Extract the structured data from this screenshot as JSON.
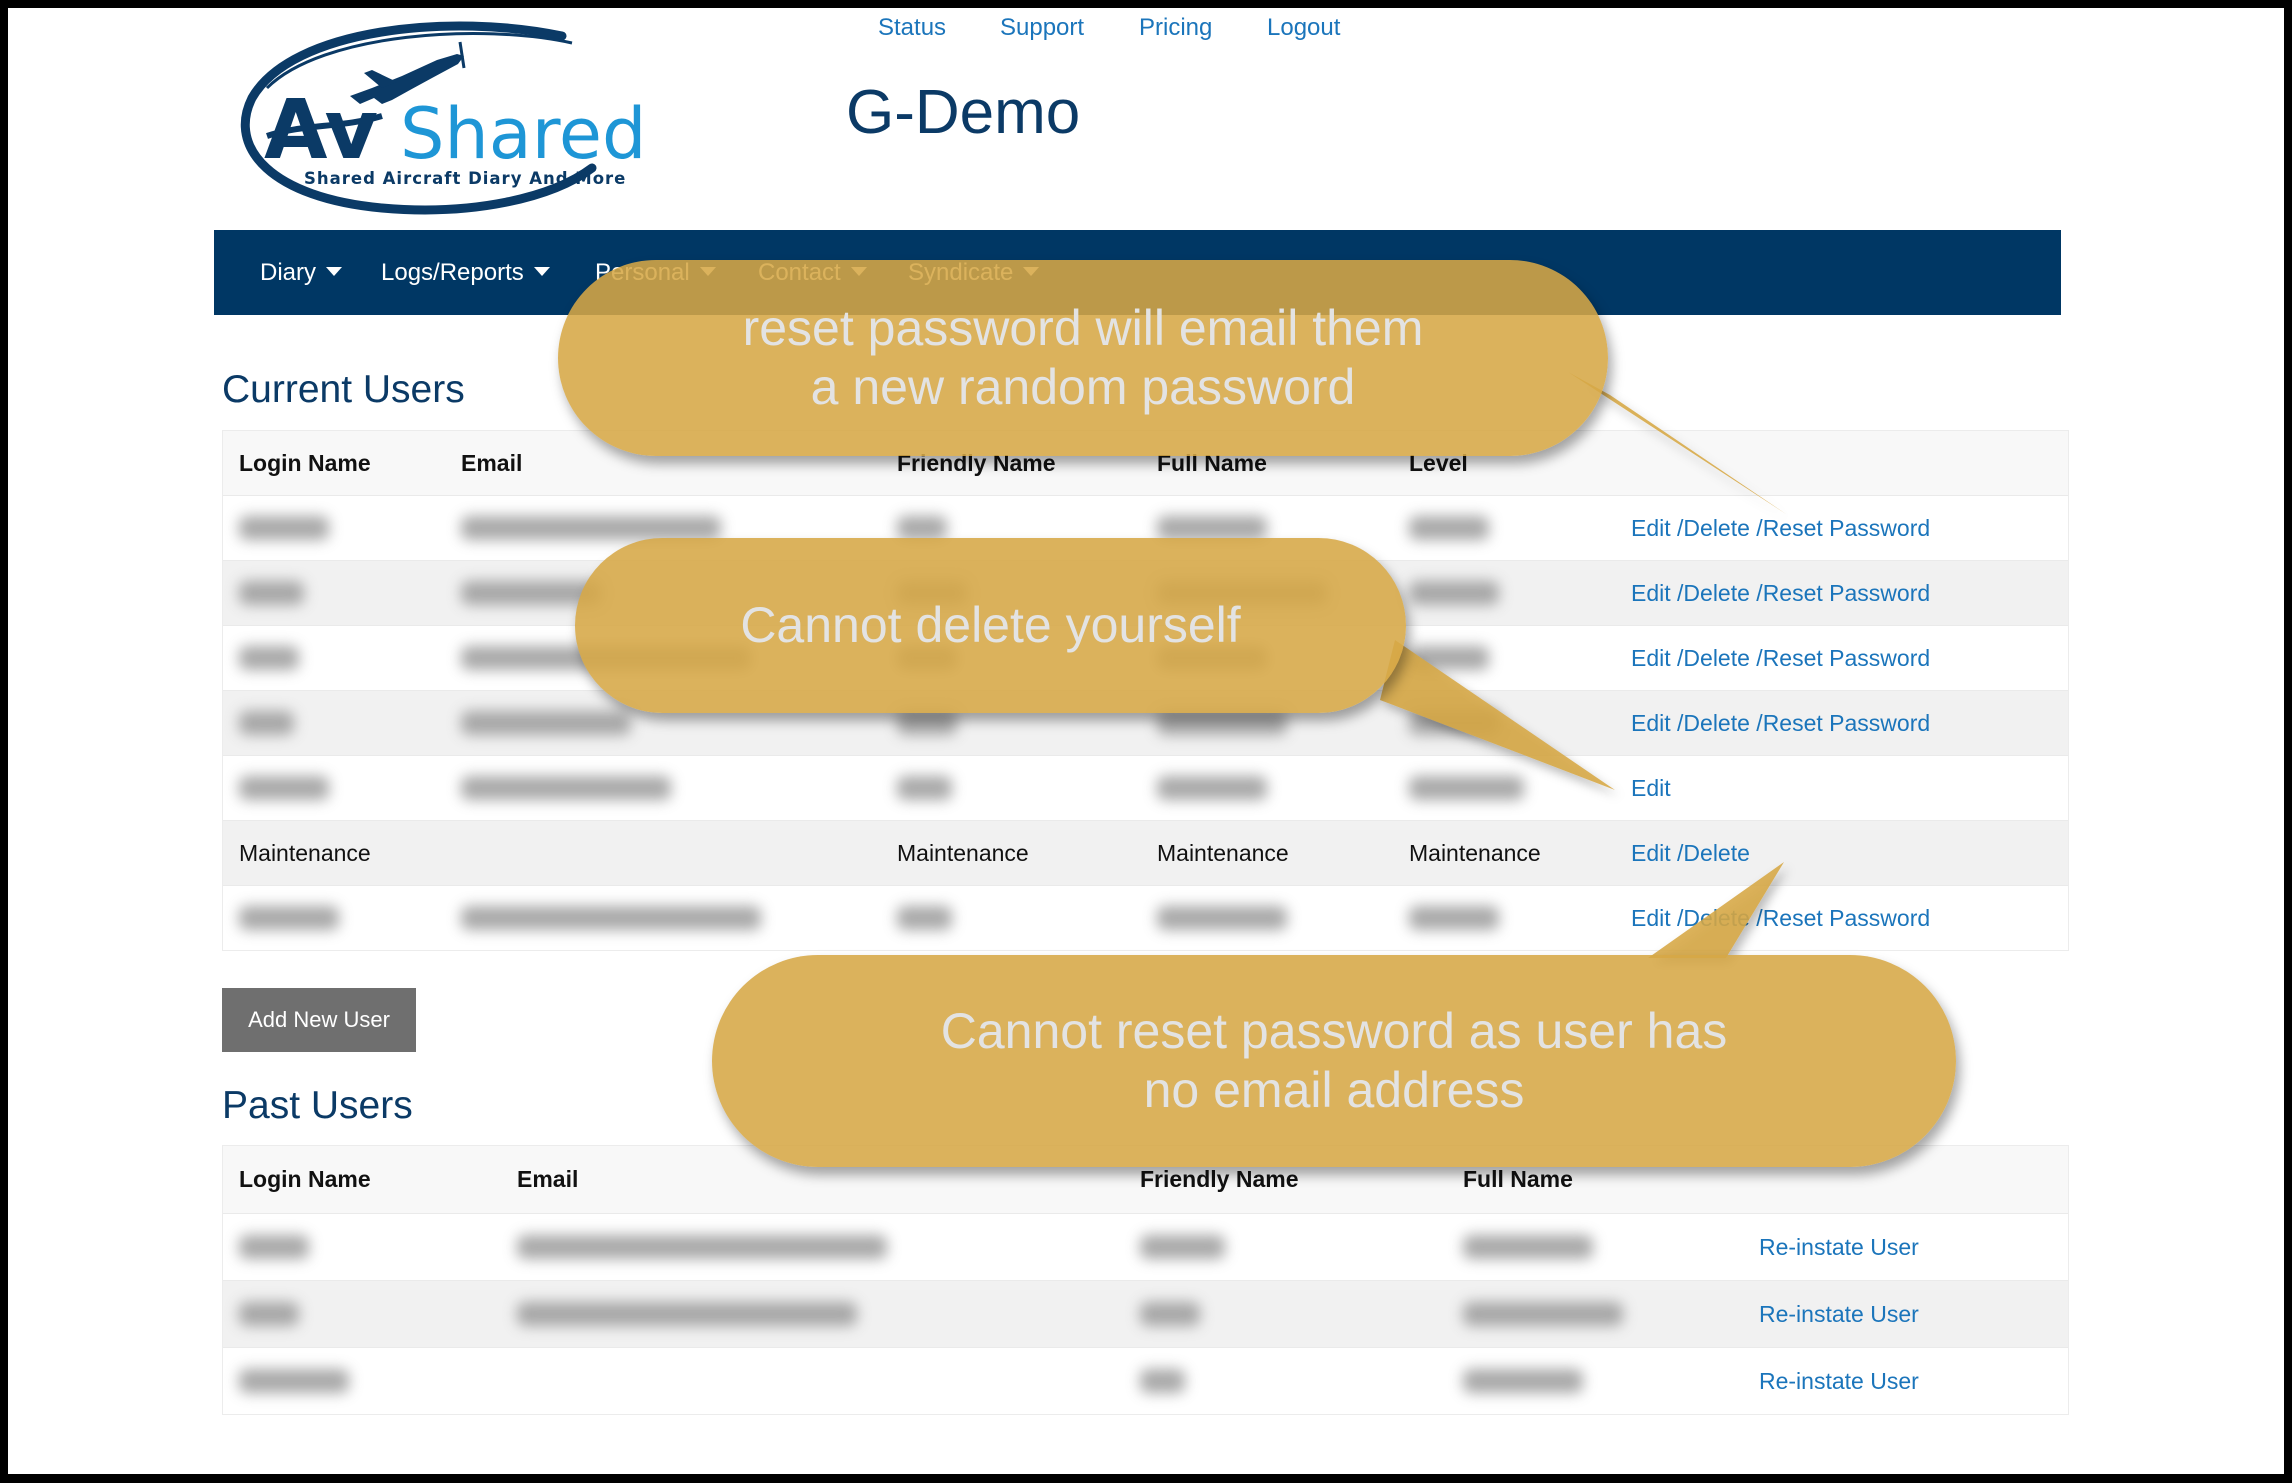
{
  "logo": {
    "brand_dark": "Av",
    "brand_light": "Shared",
    "tagline": "Shared Aircraft Diary And More",
    "colors": {
      "navy": "#0b3a66",
      "light_blue": "#1e96d6"
    }
  },
  "top_links": [
    {
      "label": "Status"
    },
    {
      "label": "Support"
    },
    {
      "label": "Pricing"
    },
    {
      "label": "Logout"
    }
  ],
  "site_title": "G-Demo",
  "nav": {
    "items": [
      {
        "label": "Diary",
        "has_dropdown": true
      },
      {
        "label": "Logs/Reports",
        "has_dropdown": true
      },
      {
        "label": "Personal",
        "has_dropdown": true
      },
      {
        "label": "Contact",
        "has_dropdown": true
      },
      {
        "label": "Syndicate",
        "has_dropdown": true
      }
    ],
    "background": "#003764"
  },
  "current_users": {
    "title": "Current Users",
    "columns": [
      "Login Name",
      "Email",
      "Friendly Name",
      "Full Name",
      "Level",
      ""
    ],
    "rows": [
      {
        "login": null,
        "email": null,
        "friendly": null,
        "full": null,
        "level": null,
        "redacted": true,
        "actions": [
          "Edit /",
          "Delete /",
          "Reset Password"
        ]
      },
      {
        "login": null,
        "email": null,
        "friendly": null,
        "full": null,
        "level": null,
        "redacted": true,
        "actions": [
          "Edit /",
          "Delete /",
          "Reset Password"
        ]
      },
      {
        "login": null,
        "email": null,
        "friendly": null,
        "full": null,
        "level": null,
        "redacted": true,
        "actions": [
          "Edit /",
          "Delete /",
          "Reset Password"
        ]
      },
      {
        "login": null,
        "email": null,
        "friendly": null,
        "full": null,
        "level": null,
        "redacted": true,
        "actions": [
          "Edit /",
          "Delete /",
          "Reset Password"
        ]
      },
      {
        "login": null,
        "email": null,
        "friendly": null,
        "full": null,
        "level": null,
        "redacted": true,
        "actions": [
          "Edit"
        ]
      },
      {
        "login": "Maintenance",
        "email": "",
        "friendly": "Maintenance",
        "full": "Maintenance",
        "level": "Maintenance",
        "redacted": false,
        "actions": [
          "Edit /",
          "Delete"
        ]
      },
      {
        "login": null,
        "email": null,
        "friendly": null,
        "full": null,
        "level": null,
        "redacted": true,
        "actions": [
          "Edit /",
          "Delete /",
          "Reset Password"
        ]
      }
    ],
    "add_button": "Add New User"
  },
  "past_users": {
    "title": "Past Users",
    "columns": [
      "Login Name",
      "Email",
      "Friendly Name",
      "Full Name",
      ""
    ],
    "rows": [
      {
        "login": null,
        "email": null,
        "friendly": null,
        "full": null,
        "redacted": true,
        "action": "Re-instate User"
      },
      {
        "login": null,
        "email": null,
        "friendly": null,
        "full": null,
        "redacted": true,
        "action": "Re-instate User"
      },
      {
        "login": null,
        "email": "",
        "friendly": null,
        "full": null,
        "redacted": true,
        "action": "Re-instate User"
      }
    ]
  },
  "callouts": [
    {
      "text": "reset password will email them\na new random password"
    },
    {
      "text": "Cannot delete yourself"
    },
    {
      "text": "Cannot reset password as user has\nno email address"
    }
  ],
  "colors": {
    "link": "#1b75bb",
    "heading": "#0b3a66",
    "callout": "#d6a745",
    "button": "#6f6f6f"
  }
}
